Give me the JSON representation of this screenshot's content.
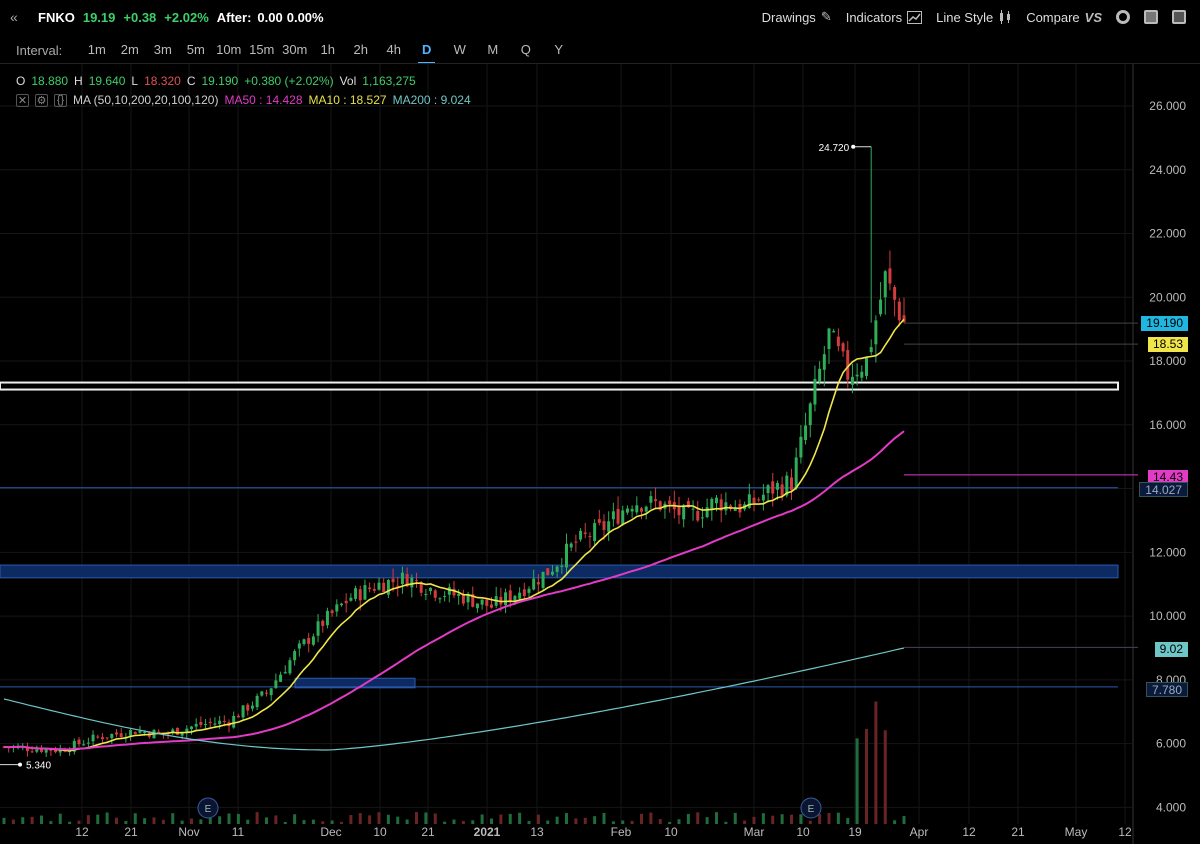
{
  "header": {
    "symbol": "FNKO",
    "last": "19.19",
    "change": "+0.38",
    "change_pct": "+2.02%",
    "after_label": "After:",
    "after_value": "0.00",
    "after_pct": "0.00%",
    "buttons": {
      "drawings": "Drawings",
      "indicators": "Indicators",
      "line_style": "Line Style",
      "compare": "Compare",
      "compare_icon": "VS"
    }
  },
  "intervals": {
    "label": "Interval:",
    "items": [
      "1m",
      "2m",
      "3m",
      "5m",
      "10m",
      "15m",
      "30m",
      "1h",
      "2h",
      "4h",
      "D",
      "W",
      "M",
      "Q",
      "Y"
    ],
    "active": "D"
  },
  "ohlc": {
    "o_label": "O",
    "o": "18.880",
    "h_label": "H",
    "h": "19.640",
    "l_label": "L",
    "l": "18.320",
    "c_label": "C",
    "c": "19.190",
    "chg": "+0.380 (+2.02%)",
    "vol_label": "Vol",
    "vol": "1,163,275"
  },
  "study": {
    "name": "MA (50,10,200,20,100,120)",
    "ma50": "MA50 : 14.428",
    "ma10": "MA10 : 18.527",
    "ma200": "MA200 : 9.024"
  },
  "tags": {
    "last_price": "19.190",
    "ma10": "18.53",
    "ma50": "14.43",
    "hline1": "14.027",
    "ma200": "9.02",
    "hline2": "7.780"
  },
  "annotations": {
    "high": "24.720",
    "low": "5.340",
    "earnings": "E"
  },
  "colors": {
    "up": "#2fae5a",
    "down": "#d23c3c",
    "ma10": "#f0e64a",
    "ma50": "#e23bc6",
    "ma200": "#6fc6c6",
    "last_tag": "#1fb6e0",
    "zone": "#0e2a63"
  },
  "chart_data": {
    "type": "candlestick",
    "ylim": [
      3.8,
      26.5
    ],
    "y_ticks": [
      "26.000",
      "24.000",
      "22.000",
      "20.000",
      "18.000",
      "16.000",
      "14.000",
      "12.000",
      "10.000",
      "8.000",
      "6.000",
      "4.000"
    ],
    "x_ticks": [
      "12",
      "21",
      "Nov",
      "11",
      "Dec",
      "10",
      "21",
      "2021",
      "13",
      "Feb",
      "10",
      "Mar",
      "10",
      "19",
      "Apr",
      "12",
      "21",
      "May",
      "12"
    ],
    "horizontal_lines": [
      17.2,
      14.027,
      7.78
    ],
    "zones": [
      [
        11.2,
        11.6
      ],
      [
        7.75,
        8.05
      ]
    ]
  }
}
